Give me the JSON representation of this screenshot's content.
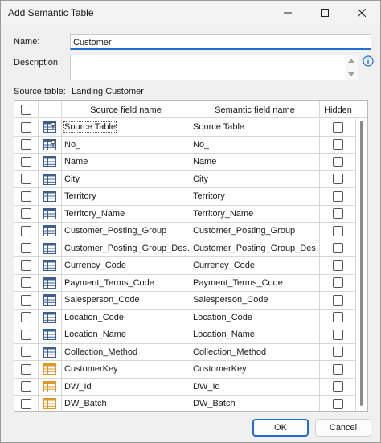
{
  "window": {
    "title": "Add Semantic Table",
    "minimize": "minimize",
    "maximize": "maximize",
    "close": "close"
  },
  "form": {
    "name_label": "Name:",
    "name_value": "Customer",
    "description_label": "Description:",
    "description_value": "",
    "source_table_label": "Source table:",
    "source_table_value": "Landing.Customer"
  },
  "grid": {
    "headers": {
      "source": "Source field name",
      "semantic": "Semantic field name",
      "hidden": "Hidden"
    },
    "rows": [
      {
        "source": "Source Table",
        "semantic": "Source Table",
        "icon": "key-table-icon"
      },
      {
        "source": "No_",
        "semantic": "No_",
        "icon": "key-table-icon"
      },
      {
        "source": "Name",
        "semantic": "Name",
        "icon": "table-field-icon"
      },
      {
        "source": "City",
        "semantic": "City",
        "icon": "table-field-icon"
      },
      {
        "source": "Territory",
        "semantic": "Territory",
        "icon": "table-field-icon"
      },
      {
        "source": "Territory_Name",
        "semantic": "Territory_Name",
        "icon": "table-field-icon"
      },
      {
        "source": "Customer_Posting_Group",
        "semantic": "Customer_Posting_Group",
        "icon": "table-field-icon"
      },
      {
        "source": "Customer_Posting_Group_Des...",
        "semantic": "Customer_Posting_Group_Des...",
        "icon": "table-field-icon"
      },
      {
        "source": "Currency_Code",
        "semantic": "Currency_Code",
        "icon": "table-field-icon"
      },
      {
        "source": "Payment_Terms_Code",
        "semantic": "Payment_Terms_Code",
        "icon": "table-field-icon"
      },
      {
        "source": "Salesperson_Code",
        "semantic": "Salesperson_Code",
        "icon": "table-field-icon"
      },
      {
        "source": "Location_Code",
        "semantic": "Location_Code",
        "icon": "table-field-icon"
      },
      {
        "source": "Location_Name",
        "semantic": "Location_Name",
        "icon": "table-field-icon"
      },
      {
        "source": "Collection_Method",
        "semantic": "Collection_Method",
        "icon": "table-field-icon"
      },
      {
        "source": "CustomerKey",
        "semantic": "CustomerKey",
        "icon": "yellow-table-field-icon"
      },
      {
        "source": "DW_Id",
        "semantic": "DW_Id",
        "icon": "yellow-table-field-icon"
      },
      {
        "source": "DW_Batch",
        "semantic": "DW_Batch",
        "icon": "yellow-table-field-icon"
      }
    ]
  },
  "buttons": {
    "ok": "OK",
    "cancel": "Cancel"
  },
  "colors": {
    "accent": "#1e6fd0",
    "info": "#1e6fd0",
    "table_icon": "#3d5f8c",
    "yellow_icon": "#d99a2b"
  }
}
